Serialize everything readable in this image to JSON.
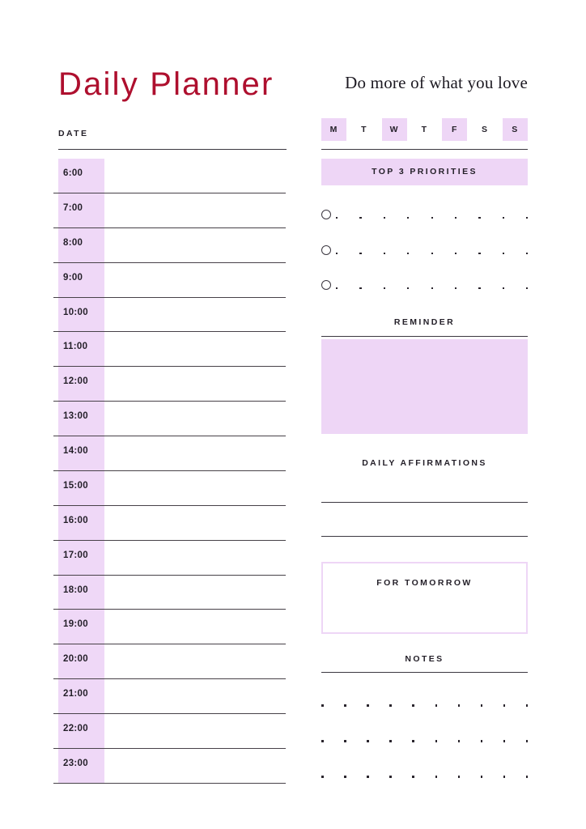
{
  "header": {
    "title": "Daily Planner",
    "tagline": "Do more of what you love",
    "date_label": "DATE"
  },
  "day_selector": {
    "days": [
      {
        "label": "M",
        "selected": true
      },
      {
        "label": "T",
        "selected": false
      },
      {
        "label": "W",
        "selected": true
      },
      {
        "label": "T",
        "selected": false
      },
      {
        "label": "F",
        "selected": true
      },
      {
        "label": "S",
        "selected": false
      },
      {
        "label": "S",
        "selected": true
      }
    ]
  },
  "schedule": {
    "hours": [
      "6:00",
      "7:00",
      "8:00",
      "9:00",
      "10:00",
      "11:00",
      "12:00",
      "13:00",
      "14:00",
      "15:00",
      "16:00",
      "17:00",
      "18:00",
      "19:00",
      "20:00",
      "21:00",
      "22:00",
      "23:00"
    ]
  },
  "priorities": {
    "title": "TOP 3 PRIORITIES",
    "items": [
      "",
      "",
      ""
    ]
  },
  "reminder": {
    "title": "REMINDER",
    "value": ""
  },
  "affirmations": {
    "title": "DAILY AFFIRMATIONS",
    "lines": [
      "",
      ""
    ]
  },
  "tomorrow": {
    "title": "FOR TOMORROW",
    "value": ""
  },
  "notes": {
    "title": "NOTES",
    "rows": [
      "",
      "",
      ""
    ]
  },
  "colors": {
    "accent_title": "#AE0F2E",
    "lavender": "#EED6F6",
    "lavender_band": "#EFD8F7",
    "rule": "#3b3740",
    "text": "#231f28"
  }
}
